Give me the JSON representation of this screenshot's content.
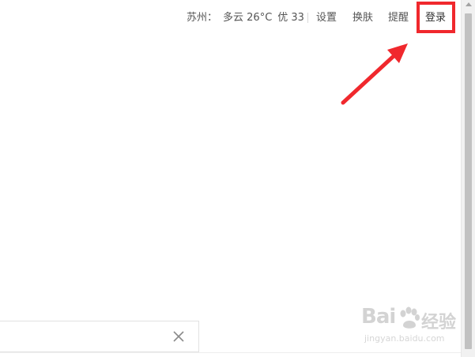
{
  "weather": {
    "city": "苏州：",
    "condition": "多云 26°C",
    "aqi": "优 33"
  },
  "nav": {
    "settings": "设置",
    "skin": "换肤",
    "remind": "提醒",
    "login": "登录"
  },
  "annotation": {
    "color": "#f0282d"
  },
  "search": {
    "close_icon": "close-icon"
  },
  "watermark": {
    "logo": "Bai",
    "brand": "经验",
    "url": "jingyan.baidu.com"
  }
}
